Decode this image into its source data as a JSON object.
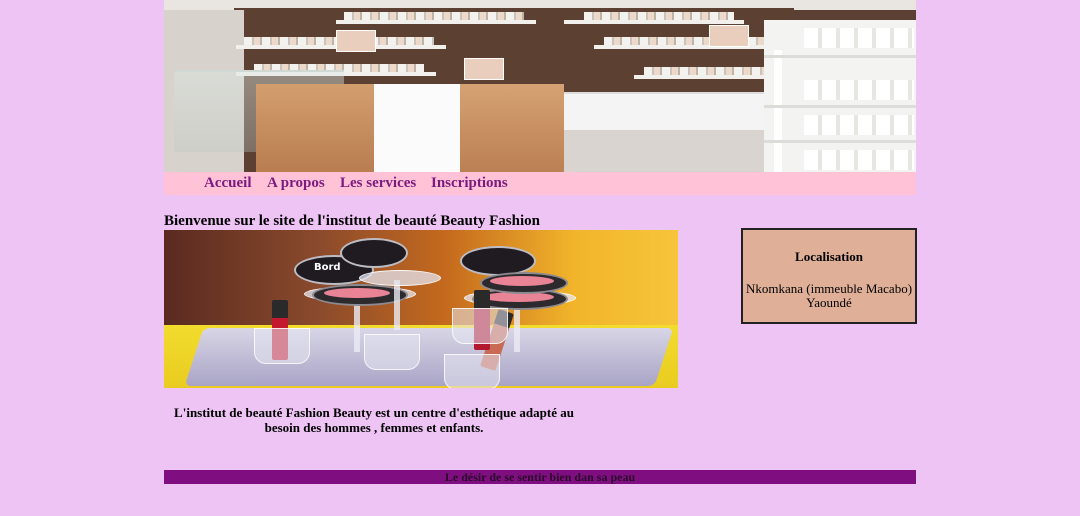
{
  "colors": {
    "page_background": "#eec4f5",
    "nav_background": "#ffc2d6",
    "nav_link": "#7b1b7f",
    "location_box": "#dfaf98",
    "footer_background": "#7f0f80"
  },
  "nav": {
    "items": [
      {
        "label": "Accueil"
      },
      {
        "label": "A propos"
      },
      {
        "label": "Les services"
      },
      {
        "label": "Inscriptions"
      }
    ]
  },
  "main": {
    "welcome_title": "Bienvenue sur le site de l'institut de beauté Beauty Fashion",
    "photo_logo_text": "Bord",
    "description": "L'institut de beauté Fashion Beauty est un centre d'esthétique adapté au besoin des hommes , femmes et enfants."
  },
  "location": {
    "title": "Localisation",
    "address_line1": "Nkomkana (immeuble Macabo)",
    "address_line2": "Yaoundé"
  },
  "footer": {
    "text": "Le désir de se sentir bien dan sa peau"
  }
}
